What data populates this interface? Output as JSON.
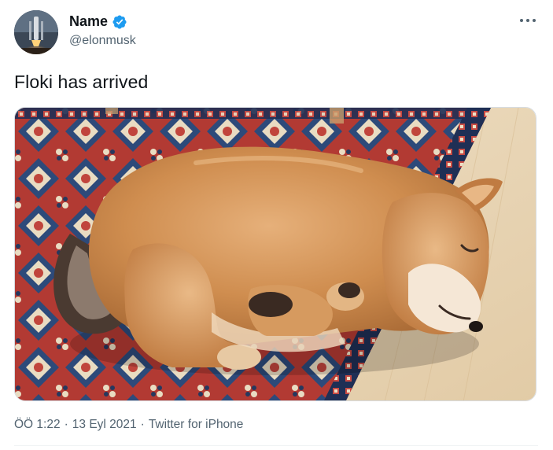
{
  "author": {
    "display_name": "Name",
    "handle": "@elonmusk",
    "verified_icon": "verified-badge-icon",
    "avatar_icon": "rocket-launch-avatar"
  },
  "menu": {
    "more_icon": "more-horizontal-icon"
  },
  "tweet": {
    "text": "Floki has arrived",
    "media": "photo of a shiba inu puppy sleeping on a patterned rug"
  },
  "meta": {
    "time": "ÖÖ 1:22",
    "separator1": "·",
    "date": "13 Eyl 2021",
    "separator2": "·",
    "source": "Twitter for iPhone"
  },
  "colors": {
    "text_primary": "#0f1419",
    "text_secondary": "#536471",
    "verified_blue": "#1d9bf0",
    "divider": "#eff3f4"
  }
}
